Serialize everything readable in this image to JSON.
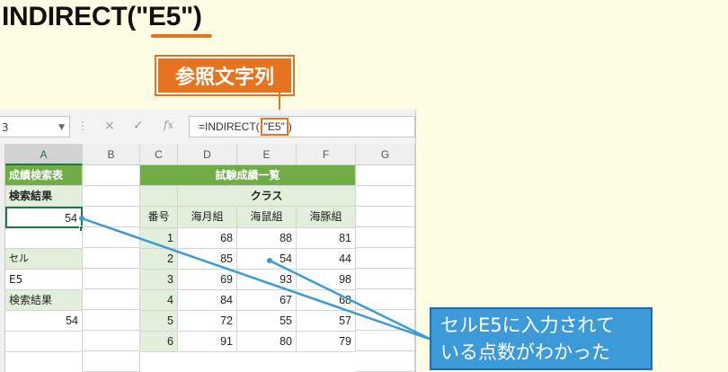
{
  "formula": "INDIRECT(\"E5\")",
  "label": "参照文字列",
  "formula_bar": {
    "name_box": "3",
    "cancel_icon": "×",
    "enter_icon": "✓",
    "fx": "fx",
    "formula_prefix": "=INDIRECT(",
    "formula_arg": "\"E5\"",
    "formula_suffix": ")"
  },
  "columns": [
    "A",
    "B",
    "C",
    "D",
    "E",
    "F",
    "G"
  ],
  "left_table": {
    "title": "成績検索表",
    "result_label": "検索結果",
    "result_value": "54",
    "cell_label": "セル",
    "cell_value": "E5",
    "result_label2": "検索結果",
    "result_value2": "54"
  },
  "right_table": {
    "title": "試験成績一覧",
    "class_header": "クラス",
    "no_header": "番号",
    "class_names": [
      "海月組",
      "海鼠組",
      "海豚組"
    ],
    "rows": [
      {
        "no": "1",
        "d": "68",
        "e": "88",
        "f": "81"
      },
      {
        "no": "2",
        "d": "85",
        "e": "54",
        "f": "44"
      },
      {
        "no": "3",
        "d": "69",
        "e": "93",
        "f": "98"
      },
      {
        "no": "4",
        "d": "84",
        "e": "67",
        "f": "68"
      },
      {
        "no": "5",
        "d": "72",
        "e": "55",
        "f": "57"
      },
      {
        "no": "6",
        "d": "91",
        "e": "80",
        "f": "79"
      }
    ]
  },
  "callout": {
    "line1": "セルE5に入力されて",
    "line2": "いる点数がわかった"
  },
  "colors": {
    "accent_orange": "#e8731e",
    "header_green": "#70ad47",
    "light_green": "#e2efda",
    "callout_blue": "#3d9ad8",
    "background": "#fffde3"
  }
}
